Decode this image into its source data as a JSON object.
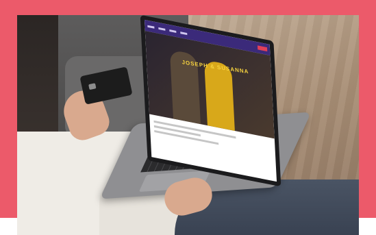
{
  "screen": {
    "hero_text": "JOSEPH & SUSANNA"
  },
  "colors": {
    "frame_pink": "#ec5a6a",
    "nav_purple": "#3b2a7a",
    "nav_button_red": "#e04058"
  }
}
